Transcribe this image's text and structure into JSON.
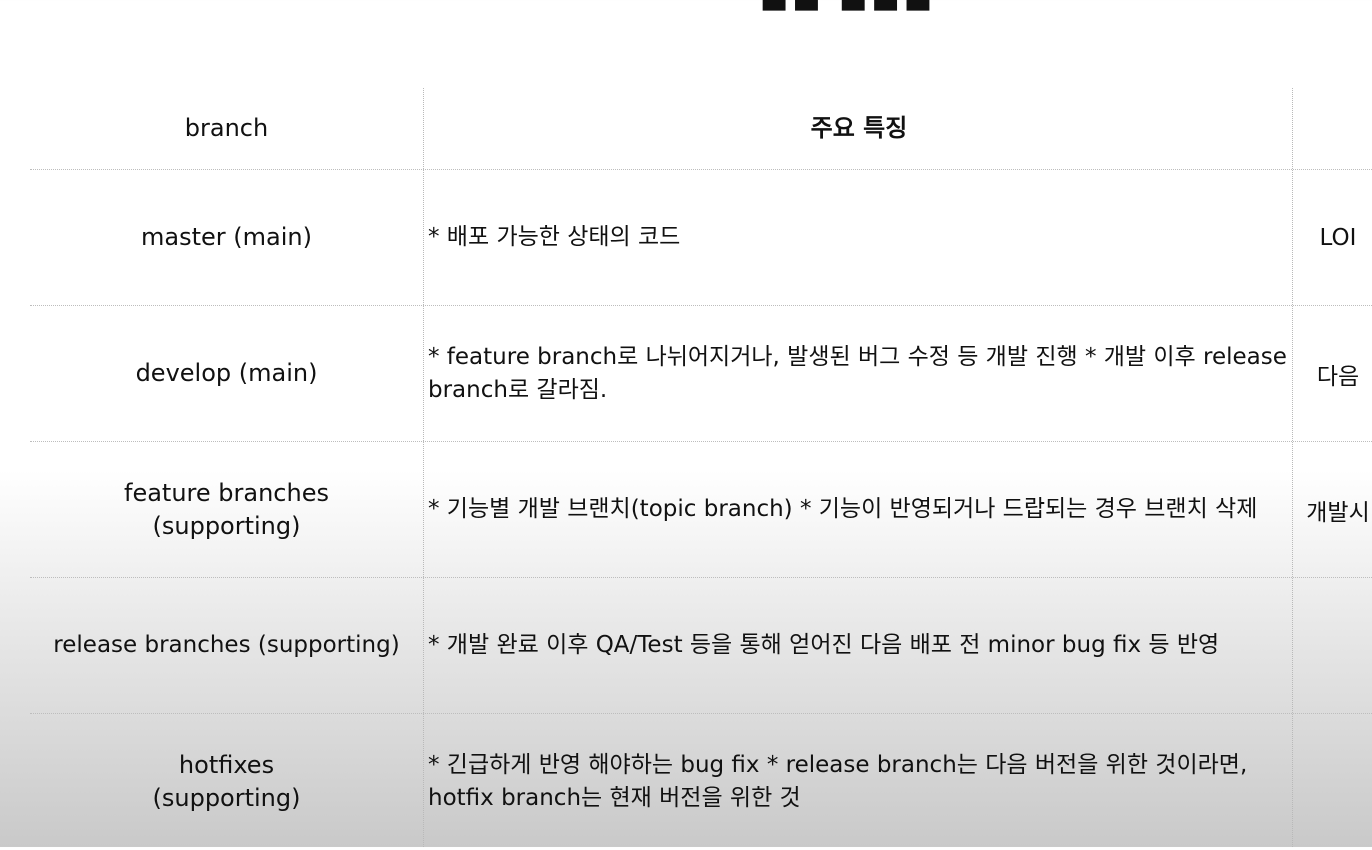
{
  "table": {
    "headers": [
      "branch",
      "주요 특징",
      ""
    ],
    "rows": [
      {
        "branch": "master (main)",
        "feature": "* 배포 가능한 상태의 코드",
        "note": "LOI"
      },
      {
        "branch": "develop (main)",
        "feature": "* feature branch로 나뉘어지거나,   발생된 버그 수정 등 개발 진행  * 개발 이후 release branch로 갈라짐.",
        "note": "다음"
      },
      {
        "branch": "feature branches (supporting)",
        "feature": "* 기능별 개발 브랜치(topic branch)  * 기능이 반영되거나 드랍되는 경우 브랜치 삭제",
        "note": "개발시"
      },
      {
        "branch": "release branches (supporting)",
        "feature": "* 개발 완료 이후 QA/Test 등을 통해 얻어진   다음 배포 전 minor bug fix 등 반영",
        "note": ""
      },
      {
        "branch": "hotfixes (supporting)",
        "feature": "* 긴급하게 반영 해야하는 bug fix  * release branch는 다음 버전을 위한 것이라면,  hotfix branch는 현재 버전을 위한 것",
        "note": ""
      }
    ]
  }
}
